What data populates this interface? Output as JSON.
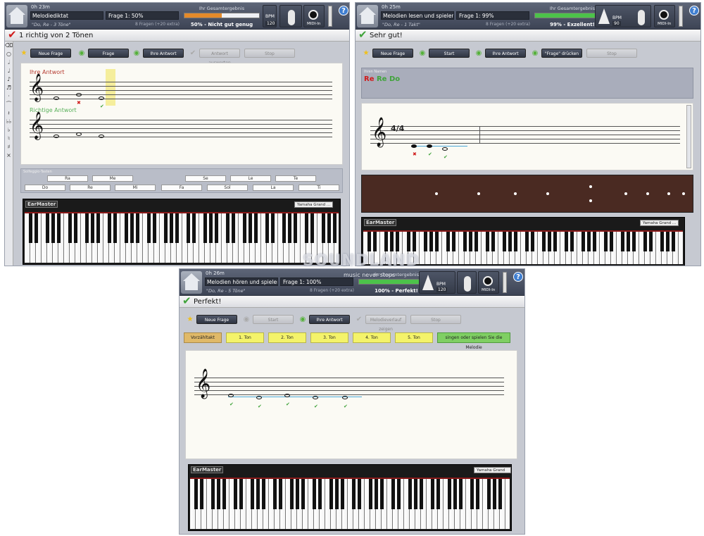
{
  "watermark": {
    "line1": "SOUNDLAND",
    "line2": "music never stops"
  },
  "common": {
    "results_label": "Ihr Gesamtergebnis",
    "bpm_label": "BPM",
    "midi_label": "MIDI-In",
    "help_glyph": "?",
    "piano_logo": "EarMaster",
    "piano_sound": "Yamaha Grand ..."
  },
  "panels": [
    {
      "timer": "0h 23m",
      "exercise": "Melodiediktat",
      "exercise_sub": "\"Do, Re - 3 Töne\"",
      "question": "Frage 1: 50%",
      "question_count": "8 Fragen (+20 extra)",
      "result_text": "50% - Nicht gut genug",
      "result_pct": 0.5,
      "result_color": "#e48a2a",
      "bpm": "120",
      "status": "1 richtig von 2 Tönen",
      "status_icon": "red-check",
      "buttons": [
        "Neue Frage",
        "Frage",
        "Ihre Antwort",
        "Antwort auswerten",
        "Stop"
      ],
      "your_answer_label": "Ihre Antwort",
      "correct_answer_label": "Richtige Antwort",
      "solfege_label": "Solfeggio-Tasten",
      "solfege_top": [
        "Ra",
        "Me",
        "Se",
        "Le",
        "Te"
      ],
      "solfege_bottom": [
        "Do",
        "Re",
        "Mi",
        "Fa",
        "Sol",
        "La",
        "Ti"
      ]
    },
    {
      "timer": "0h 25m",
      "exercise": "Melodien lesen und spielen",
      "exercise_sub": "\"Do, Re - 1 Takt\"",
      "question": "Frage 1: 99%",
      "question_count": "8 Fragen (+20 extra)",
      "result_text": "99% - Exzellent!",
      "result_pct": 0.99,
      "result_color": "#4cc24a",
      "bpm": "90",
      "status": "Sehr gut!",
      "status_icon": "green-check",
      "buttons": [
        "Neue Frage",
        "Start",
        "Ihre Antwort",
        "\"Frage\" drücken",
        "Stop"
      ],
      "answer_label": "Ihren Namen",
      "answer_notes": [
        "Re",
        "Re",
        "Do"
      ],
      "time_sig": "4/4"
    },
    {
      "timer": "0h 26m",
      "exercise": "Melodien hören und spielen",
      "exercise_sub": "\"Do, Re - 5 Töne\"",
      "question": "Frage 1: 100%",
      "question_count": "8 Fragen (+20 extra)",
      "result_text": "100% - Perfekt!",
      "result_pct": 1.0,
      "result_color": "#4cc24a",
      "bpm": "120",
      "status": "Perfekt!",
      "status_icon": "green-check",
      "buttons": [
        "Neue Frage",
        "Start",
        "Ihre Antwort",
        "Melodieverlauf zeigen",
        "Stop"
      ],
      "tone_buttons": [
        "Vorzähltakt",
        "1. Ton",
        "2. Ton",
        "3. Ton",
        "4. Ton",
        "5. Ton",
        "singen oder spielen Sie die Melodie"
      ]
    }
  ]
}
